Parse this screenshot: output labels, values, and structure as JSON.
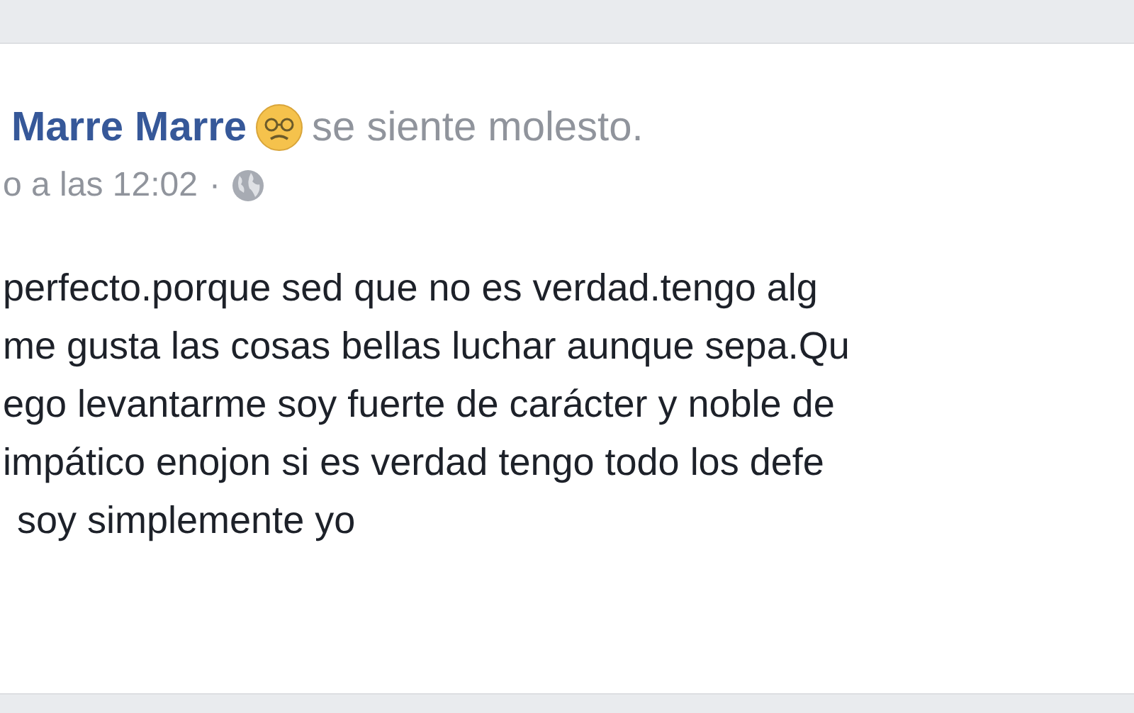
{
  "post": {
    "author": "Marre Marre",
    "feeling": "se siente molesto.",
    "timestamp": "o a las 12:02",
    "separator": "·",
    "body_lines": [
      "perfecto.porque sed que no es verdad.tengo alg",
      "me gusta las cosas bellas luchar aunque sepa.Qu",
      "ego levantarme soy fuerte de carácter y noble de",
      "impático enojon si es verdad tengo todo los defe",
      "soy simplemente yo"
    ]
  }
}
